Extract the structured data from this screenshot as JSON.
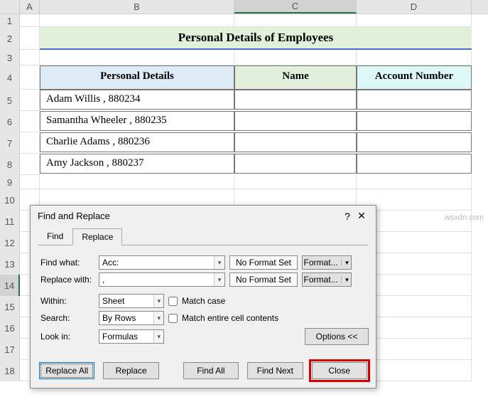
{
  "columns": [
    "A",
    "B",
    "C",
    "D"
  ],
  "rows": [
    "1",
    "2",
    "3",
    "4",
    "5",
    "6",
    "7",
    "8",
    "9",
    "10",
    "11",
    "12",
    "13",
    "14",
    "15",
    "16",
    "17",
    "18"
  ],
  "title": "Personal Details of Employees",
  "headers": {
    "b": "Personal Details",
    "c": "Name",
    "d": "Account Number"
  },
  "data_rows": [
    {
      "b": "Adam Willis , 880234",
      "c": "",
      "d": ""
    },
    {
      "b": "Samantha Wheeler , 880235",
      "c": "",
      "d": ""
    },
    {
      "b": "Charlie Adams , 880236",
      "c": "",
      "d": ""
    },
    {
      "b": "Amy Jackson , 880237",
      "c": "",
      "d": ""
    }
  ],
  "dialog": {
    "title": "Find and Replace",
    "help": "?",
    "close_icon": "✕",
    "tabs": {
      "find": "Find",
      "replace": "Replace"
    },
    "find_what_label": "Find what:",
    "find_what_value": "Acc:",
    "replace_with_label": "Replace with:",
    "replace_with_value": ",",
    "no_format": "No Format Set",
    "format_btn": "Format...",
    "within_label": "Within:",
    "within_value": "Sheet",
    "search_label": "Search:",
    "search_value": "By Rows",
    "lookin_label": "Look in:",
    "lookin_value": "Formulas",
    "match_case": "Match case",
    "match_entire": "Match entire cell contents",
    "options_btn": "Options <<",
    "replace_all": "Replace All",
    "replace": "Replace",
    "find_all": "Find All",
    "find_next": "Find Next",
    "close": "Close"
  },
  "watermark": "wsxdn.com"
}
